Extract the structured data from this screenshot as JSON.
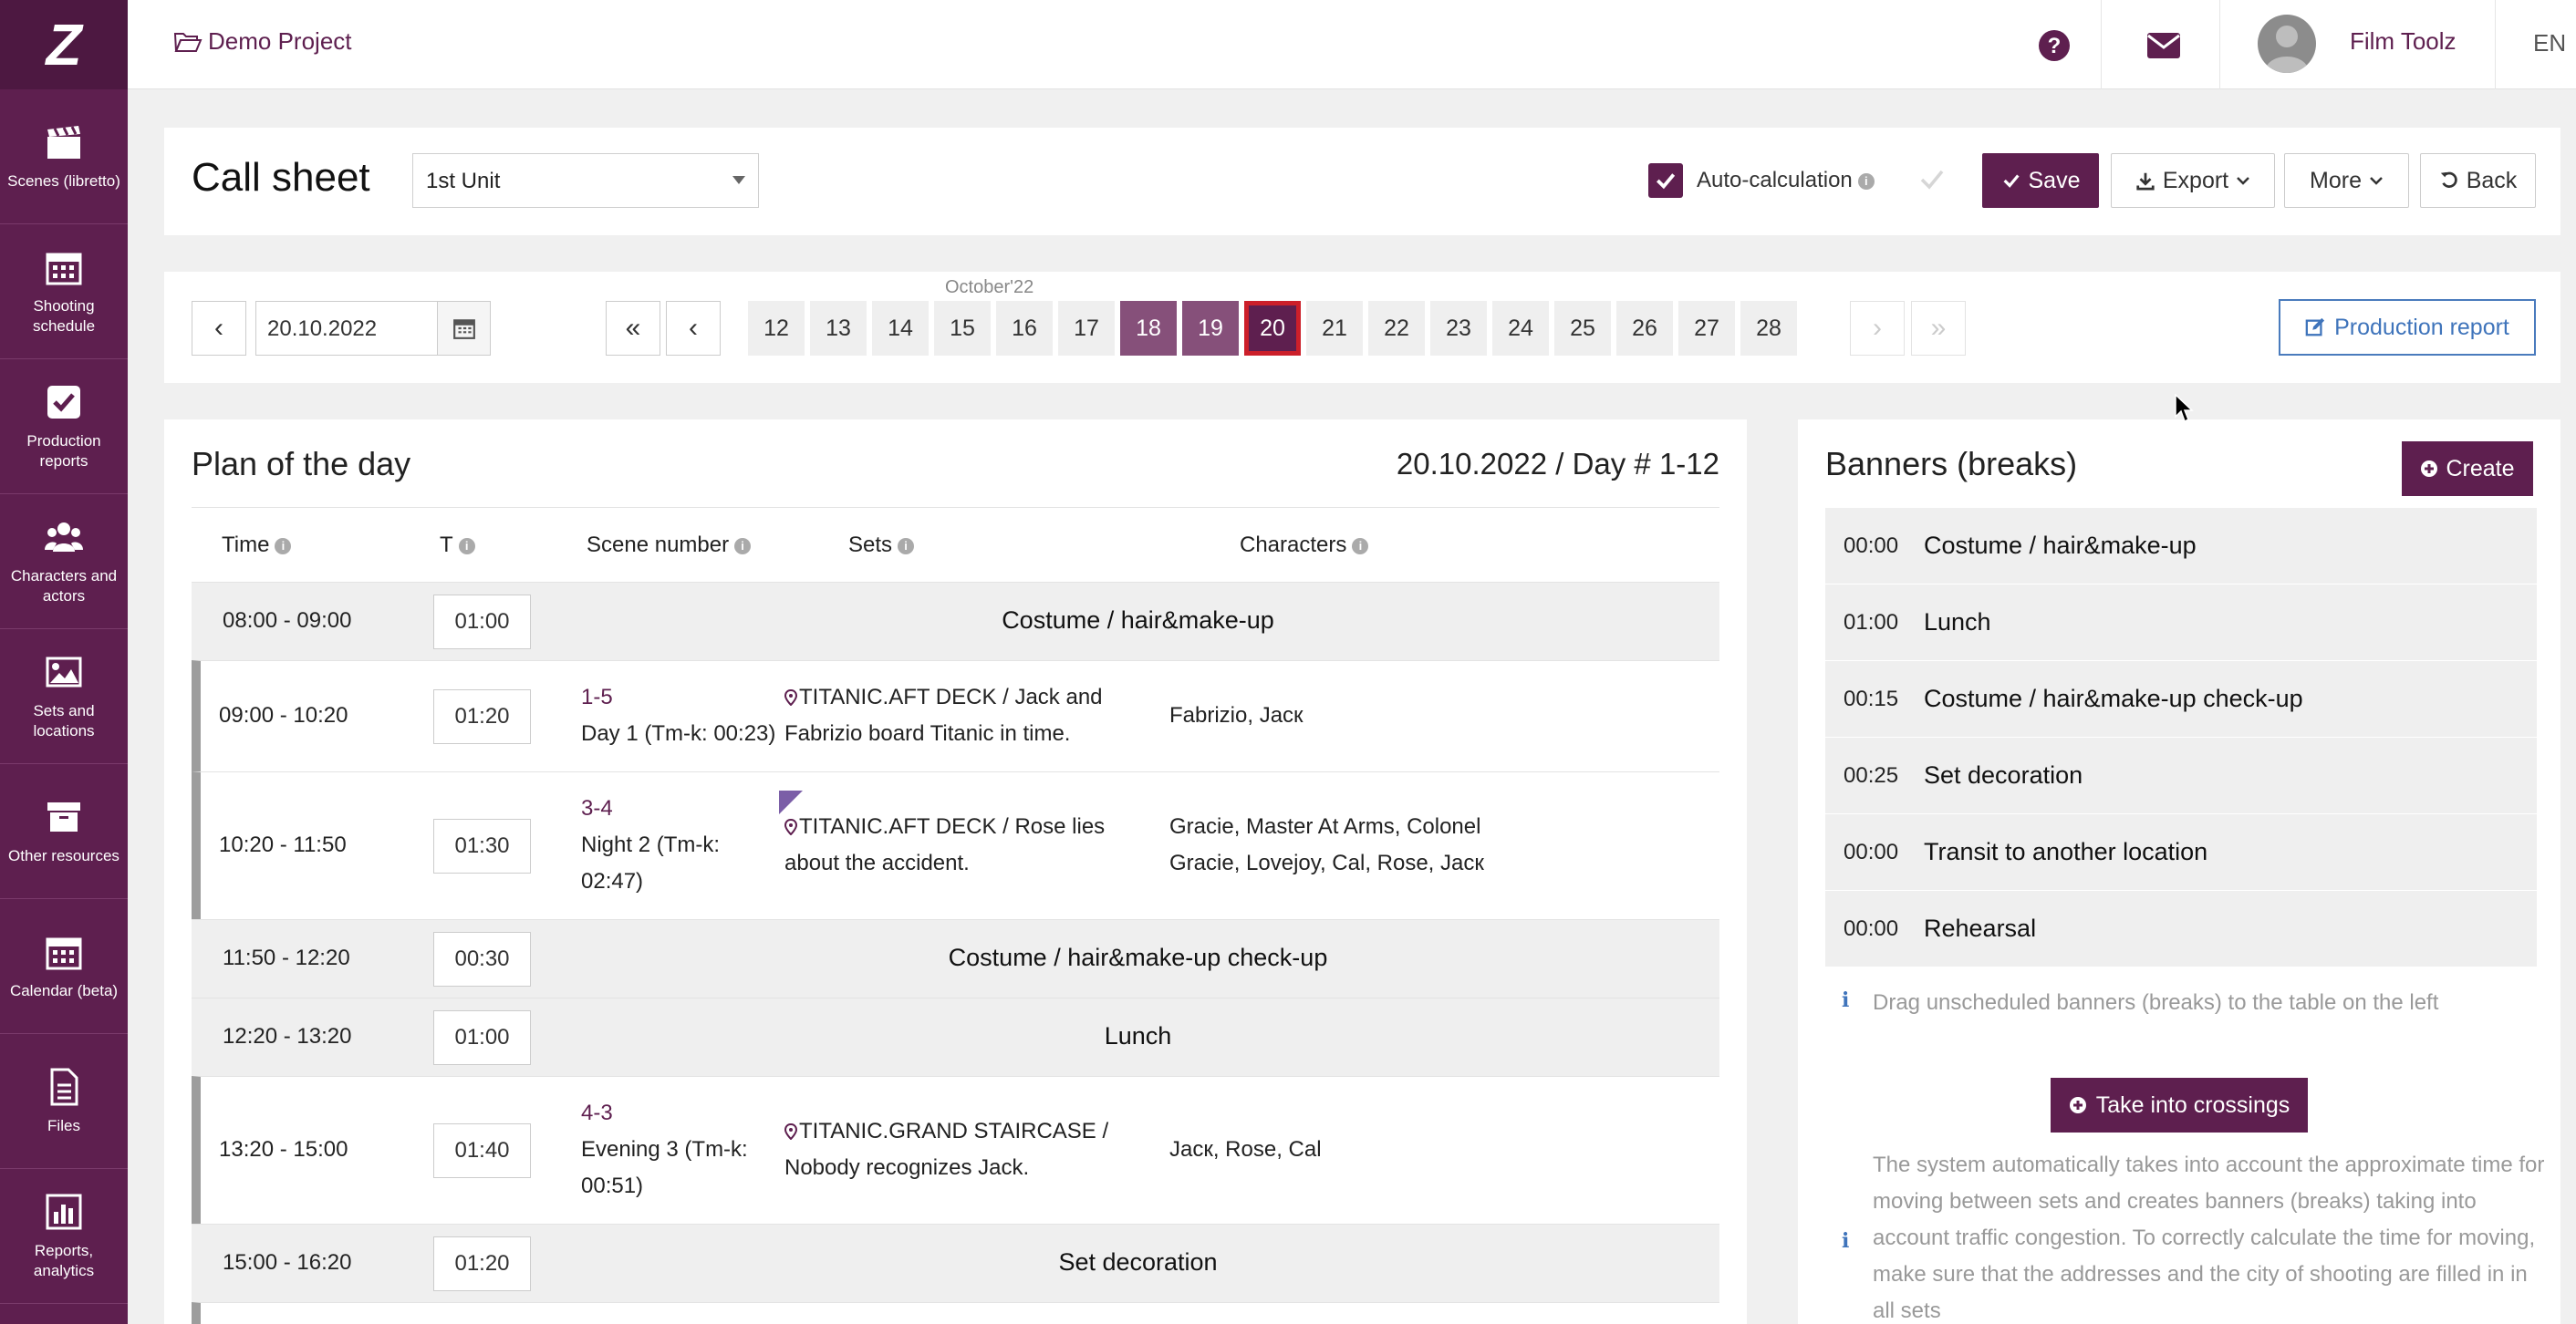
{
  "sidebar": {
    "logo": "Z",
    "items": [
      {
        "label": "Scenes (libretto)",
        "icon": "clapperboard-icon"
      },
      {
        "label": "Shooting schedule",
        "icon": "calendar-icon"
      },
      {
        "label": "Production reports",
        "icon": "check-square-icon"
      },
      {
        "label": "Characters and actors",
        "icon": "users-icon"
      },
      {
        "label": "Sets and locations",
        "icon": "image-icon"
      },
      {
        "label": "Other resources",
        "icon": "archive-icon"
      },
      {
        "label": "Calendar (beta)",
        "icon": "calendar-icon"
      },
      {
        "label": "Files",
        "icon": "file-icon"
      },
      {
        "label": "Reports, analytics",
        "icon": "bar-chart-icon"
      }
    ]
  },
  "topbar": {
    "project": "Demo Project",
    "user": "Film Toolz",
    "language": "EN"
  },
  "header": {
    "title": "Call sheet",
    "unit": "1st Unit",
    "auto_calc_label": "Auto-calculation",
    "auto_calc_checked": true,
    "save": "Save",
    "export": "Export",
    "more": "More",
    "back": "Back"
  },
  "date_nav": {
    "date": "20.10.2022",
    "month": "October'22",
    "days": [
      "12",
      "13",
      "14",
      "15",
      "16",
      "17",
      "18",
      "19",
      "20",
      "21",
      "22",
      "23",
      "24",
      "25",
      "26",
      "27",
      "28"
    ],
    "selected_days": [
      "18",
      "19"
    ],
    "current_day": "20",
    "production_report": "Production report"
  },
  "plan": {
    "title": "Plan of the day",
    "date_label": "20.10.2022 / Day # 1-12",
    "columns": {
      "time": "Time",
      "t": "T",
      "scene": "Scene number",
      "sets": "Sets",
      "characters": "Characters"
    },
    "rows": [
      {
        "type": "banner",
        "time": "08:00 - 09:00",
        "dur": "01:00",
        "name": "Costume / hair&make-up"
      },
      {
        "type": "scene",
        "time": "09:00 - 10:20",
        "dur": "01:20",
        "scene_no": "1-5",
        "scene_desc": "Day 1 (Tm-k: 00:23)",
        "set": "TITANIC.AFT DECK / Jack and Fabrizio board Titanic in time.",
        "characters": "Fabrizio, Jacк"
      },
      {
        "type": "scene",
        "time": "10:20 - 11:50",
        "dur": "01:30",
        "scene_no": "3-4",
        "scene_desc": "Night 2 (Tm-k: 02:47)",
        "set": "TITANIC.AFT DECK / Rose lies about the accident.",
        "characters": "Gracie, Master At Arms, Colonel Gracie, Lovejoy, Cal, Rose, Jacк"
      },
      {
        "type": "banner",
        "time": "11:50 - 12:20",
        "dur": "00:30",
        "name": "Costume / hair&make-up check-up"
      },
      {
        "type": "banner",
        "time": "12:20 - 13:20",
        "dur": "01:00",
        "name": "Lunch"
      },
      {
        "type": "scene",
        "time": "13:20 - 15:00",
        "dur": "01:40",
        "scene_no": "4-3",
        "scene_desc": "Evening 3 (Tm-k: 00:51)",
        "set": "TITANIC.GRAND STAIRCASE / Nobody recognizes Jack.",
        "characters": "Jacк, Rose, Cal"
      },
      {
        "type": "banner",
        "time": "15:00 - 16:20",
        "dur": "01:20",
        "name": "Set decoration"
      }
    ]
  },
  "banners": {
    "title": "Banners (breaks)",
    "create": "Create",
    "items": [
      {
        "time": "00:00",
        "name": "Costume / hair&make-up"
      },
      {
        "time": "01:00",
        "name": "Lunch"
      },
      {
        "time": "00:15",
        "name": "Costume / hair&make-up check-up"
      },
      {
        "time": "00:25",
        "name": "Set decoration"
      },
      {
        "time": "00:00",
        "name": "Transit to another location"
      },
      {
        "time": "00:00",
        "name": "Rehearsal"
      }
    ],
    "drag_hint": "Drag unscheduled banners (breaks) to the table on the left",
    "take_button": "Take into crossings",
    "system_note": "The system automatically takes into account the approximate time for moving between sets and creates banners (breaks) taking into account traffic congestion. To correctly calculate the time for moving, make sure that the addresses and the city of shooting are filled in in all sets"
  },
  "colors": {
    "brand": "#5e1f4f",
    "selected_day": "#86507a",
    "current_outline": "#cc1f2a",
    "link_blue": "#3f74bb"
  }
}
